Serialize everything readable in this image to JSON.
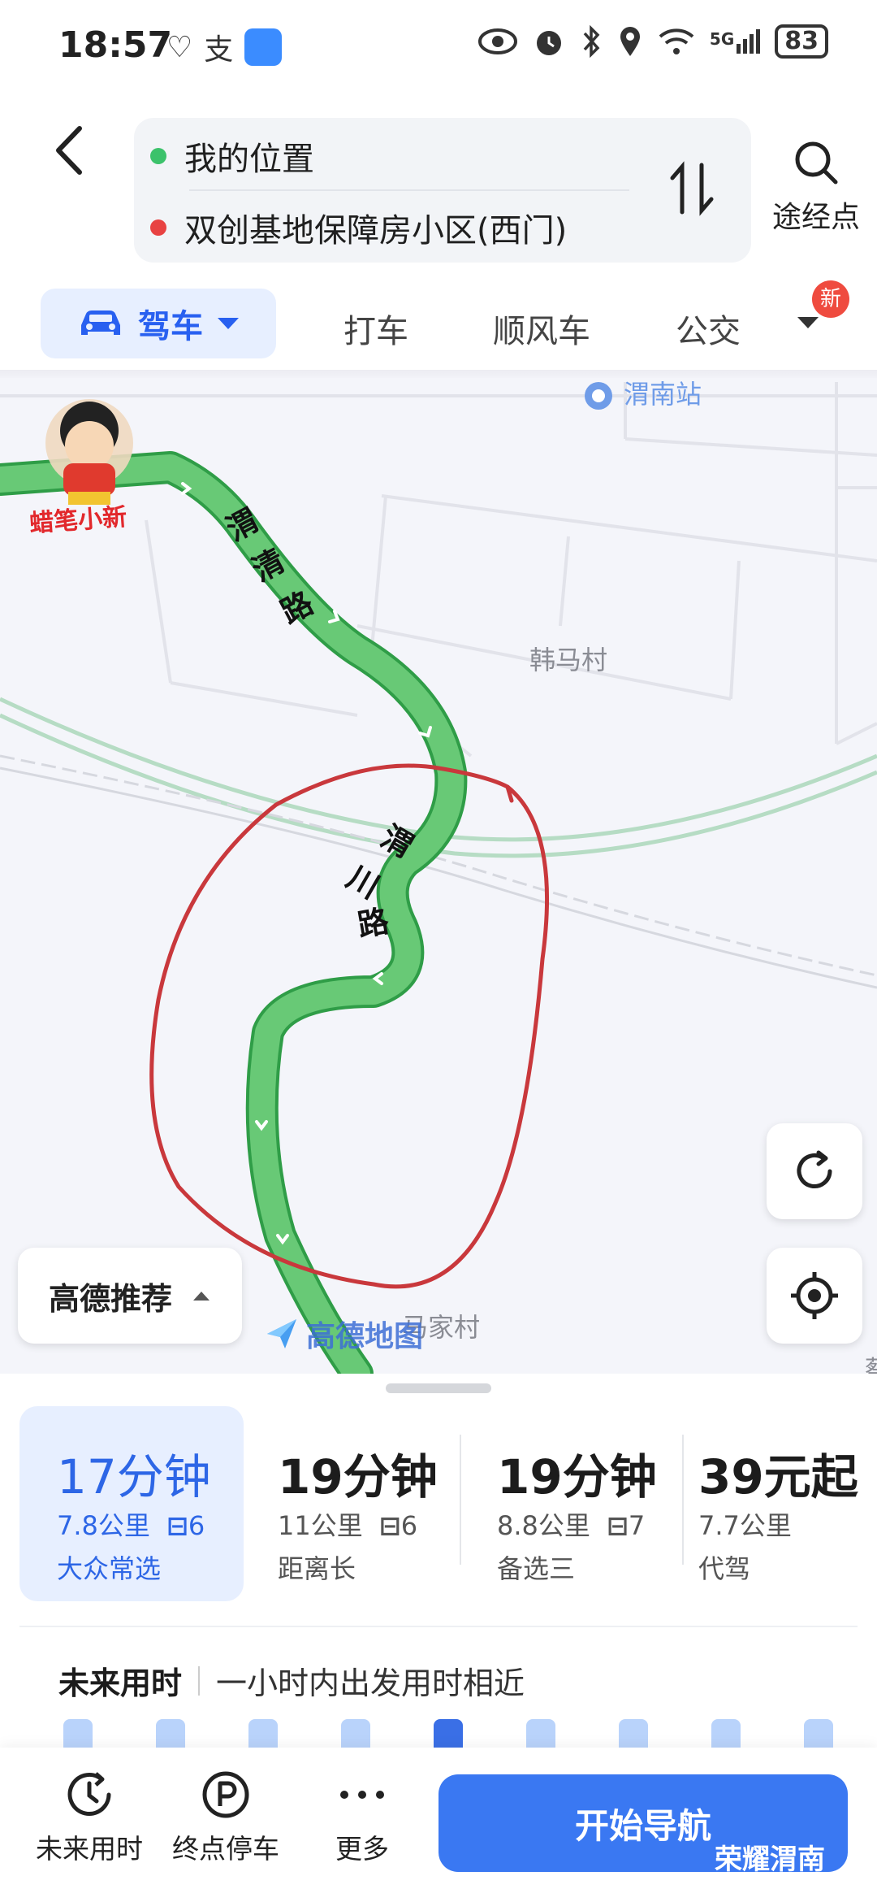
{
  "status_bar": {
    "time": "18:57",
    "left_glyphs": [
      "♡",
      "支"
    ],
    "icons": [
      "eye-icon",
      "alarm-icon",
      "bluetooth-icon",
      "location-icon",
      "wifi-icon",
      "signal-5g-icon"
    ],
    "signal_label": "5G",
    "battery": "83"
  },
  "route": {
    "origin": "我的位置",
    "destination": "双创基地保障房小区(西门)",
    "origin_color": "#3cc26b",
    "destination_color": "#e84242",
    "swap_glyph": "⇅",
    "waypoint_label": "途经点"
  },
  "modes": {
    "active": "驾车",
    "items": [
      "打车",
      "顺风车",
      "公交"
    ],
    "new_badge": "新"
  },
  "map": {
    "labels": {
      "station": "渭南站",
      "village1": "韩马村",
      "village2": "马家村",
      "road1_chars": [
        "渭",
        "清",
        "路"
      ],
      "road2_chars": [
        "渭",
        "川",
        "路"
      ],
      "sticker": "蜡笔小新",
      "edge_char": "蔡"
    },
    "recommend_label": "高德推荐",
    "logo_text": "高德地图",
    "route_color": "#5cc26a",
    "annotation_color": "#c9383c"
  },
  "routes": [
    {
      "time": "17分钟",
      "distance": "7.8公里",
      "lights": "6",
      "tag": "大众常选",
      "selected": true
    },
    {
      "time": "19分钟",
      "distance": "11公里",
      "lights": "6",
      "tag": "距离长",
      "selected": false
    },
    {
      "time": "19分钟",
      "distance": "8.8公里",
      "lights": "7",
      "tag": "备选三",
      "selected": false
    },
    {
      "time": "39元起",
      "distance": "7.7公里",
      "lights": "",
      "tag": "代驾",
      "selected": false
    }
  ],
  "future": {
    "title": "未来用时",
    "subtitle": "一小时内出发用时相近"
  },
  "toolbar": {
    "future_label": "未来用时",
    "parking_label": "终点停车",
    "more_label": "更多",
    "start_label": "开始导航",
    "watermark": "荣耀渭南"
  }
}
